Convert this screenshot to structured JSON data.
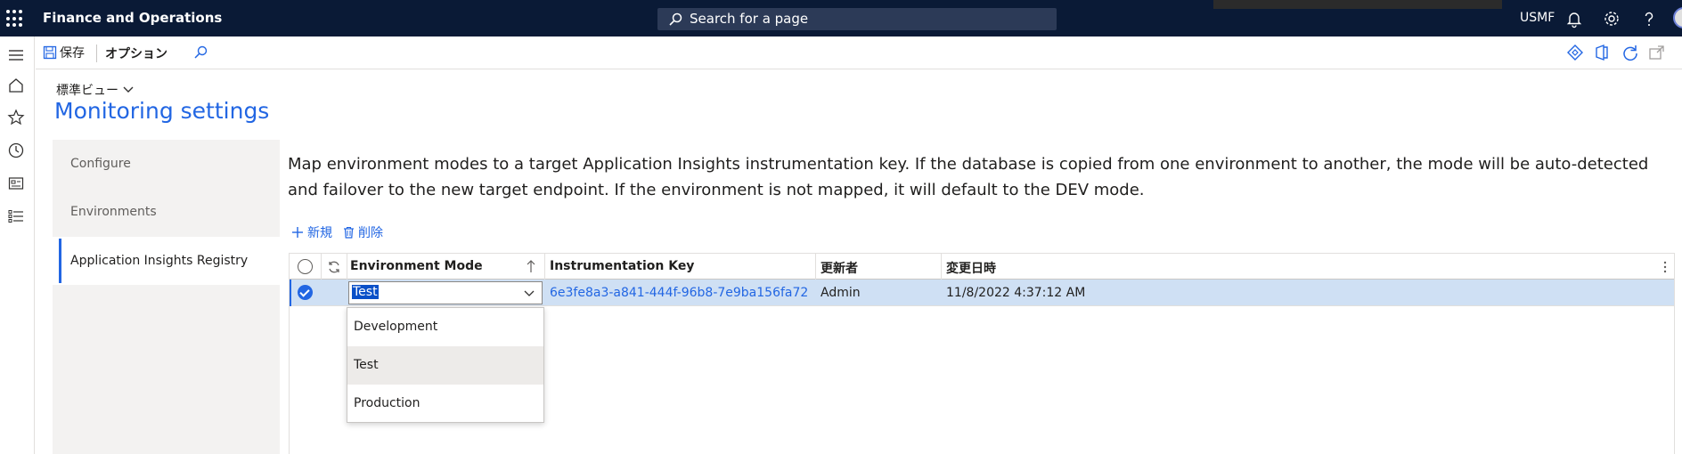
{
  "topbar": {
    "app_title": "Finance and Operations",
    "search_placeholder": "Search for a page",
    "company": "USMF",
    "icons": [
      "waffle-icon",
      "search-icon",
      "bell-icon",
      "gear-icon",
      "help-icon",
      "avatar"
    ]
  },
  "actionpane": {
    "save_label": "保存",
    "options_label": "オプション"
  },
  "header": {
    "view_selector": "標準ビュー",
    "page_title": "Monitoring settings"
  },
  "tabs": [
    {
      "label": "Configure",
      "active": false
    },
    {
      "label": "Environments",
      "active": false
    },
    {
      "label": "Application Insights Registry",
      "active": true
    }
  ],
  "description": "Map environment modes to a target Application Insights instrumentation key. If the database is copied from one environment to another, the mode will be auto-detected and failover to the new target endpoint. If the environment is not mapped, it will default to the DEV mode.",
  "grid_actions": {
    "new_label": "新規",
    "delete_label": "削除"
  },
  "grid": {
    "columns": [
      "Environment Mode",
      "Instrumentation Key",
      "更新者",
      "変更日時"
    ],
    "rows": [
      {
        "environment_mode": "Test",
        "instrumentation_key": "6e3fe8a3-a841-444f-96b8-7e9ba156fa72",
        "modified_by": "Admin",
        "modified_at": "11/8/2022 4:37:12 AM"
      }
    ]
  },
  "mode_options": [
    "Development",
    "Test",
    "Production"
  ],
  "colors": {
    "topbar": "#0a1a36",
    "accent": "#2266e3",
    "row_selected": "#cfe0f4"
  }
}
